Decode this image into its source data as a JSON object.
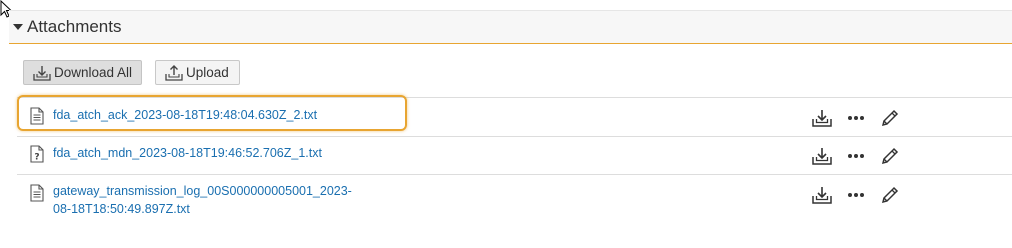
{
  "panel": {
    "title": "Attachments"
  },
  "toolbar": {
    "download_all_label": "Download All",
    "upload_label": "Upload"
  },
  "attachments": [
    {
      "name": "fda_atch_ack_2023-08-18T19:48:04.630Z_2.txt",
      "icon": "text-file-icon"
    },
    {
      "name": "fda_atch_mdn_2023-08-18T19:46:52.706Z_1.txt",
      "icon": "unknown-file-icon"
    },
    {
      "name": "gateway_transmission_log_00S000000005001_2023-08-18T18:50:49.897Z.txt",
      "icon": "text-file-icon"
    }
  ],
  "row_actions": [
    "download-icon",
    "more-options-icon",
    "edit-icon"
  ],
  "colors": {
    "accent": "#e8a531",
    "link": "#1a6fb0"
  }
}
